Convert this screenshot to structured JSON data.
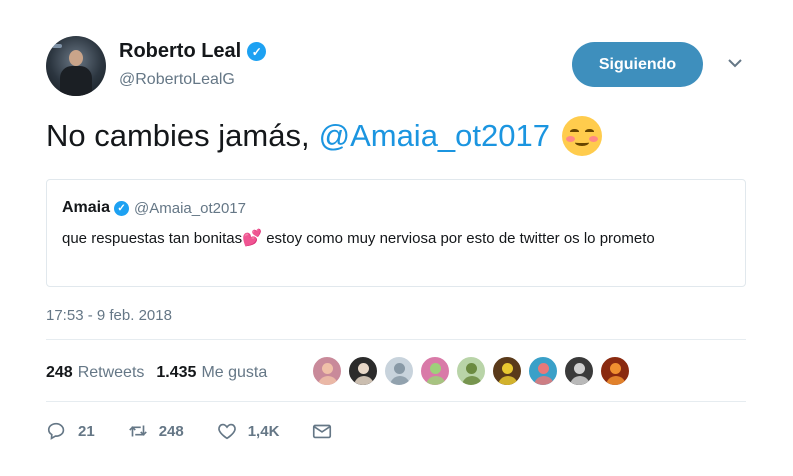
{
  "author": {
    "name": "Roberto Leal",
    "handle": "@RobertoLealG",
    "verified_icon": "verified-badge-icon"
  },
  "follow_button": {
    "label": "Siguiendo"
  },
  "menu_caret": {
    "icon": "chevron-down-icon"
  },
  "tweet": {
    "text": "No cambies jamás,",
    "mention": "@Amaia_ot2017",
    "emoji": "smiling-face-with-blush-emoji"
  },
  "quoted_tweet": {
    "name": "Amaia",
    "handle": "@Amaia_ot2017",
    "text_before": "que respuestas tan bonitas",
    "emoji": "💕",
    "text_after": " estoy como muy nerviosa por esto de twitter os lo prometo"
  },
  "timestamp": "17:53 - 9 feb. 2018",
  "stats": {
    "retweets_count": "248",
    "retweets_label": "Retweets",
    "likes_count": "1.435",
    "likes_label": "Me gusta"
  },
  "likers": [
    {
      "color": "#c98a9a",
      "accent": "#f0c0a8"
    },
    {
      "color": "#2b2b2b",
      "accent": "#e8d8c8"
    },
    {
      "color": "#c8d3dc",
      "accent": "#8899a6"
    },
    {
      "color": "#d97aa8",
      "accent": "#9ed07a"
    },
    {
      "color": "#b9d4a8",
      "accent": "#6b8a40"
    },
    {
      "color": "#5a3a1a",
      "accent": "#e8c830"
    },
    {
      "color": "#3aa0c8",
      "accent": "#e87878"
    },
    {
      "color": "#3a3a3a",
      "accent": "#d0d0d0"
    },
    {
      "color": "#8a2a10",
      "accent": "#f09030"
    }
  ],
  "actions": {
    "reply_count": "21",
    "retweet_count": "248",
    "like_count": "1,4K"
  }
}
